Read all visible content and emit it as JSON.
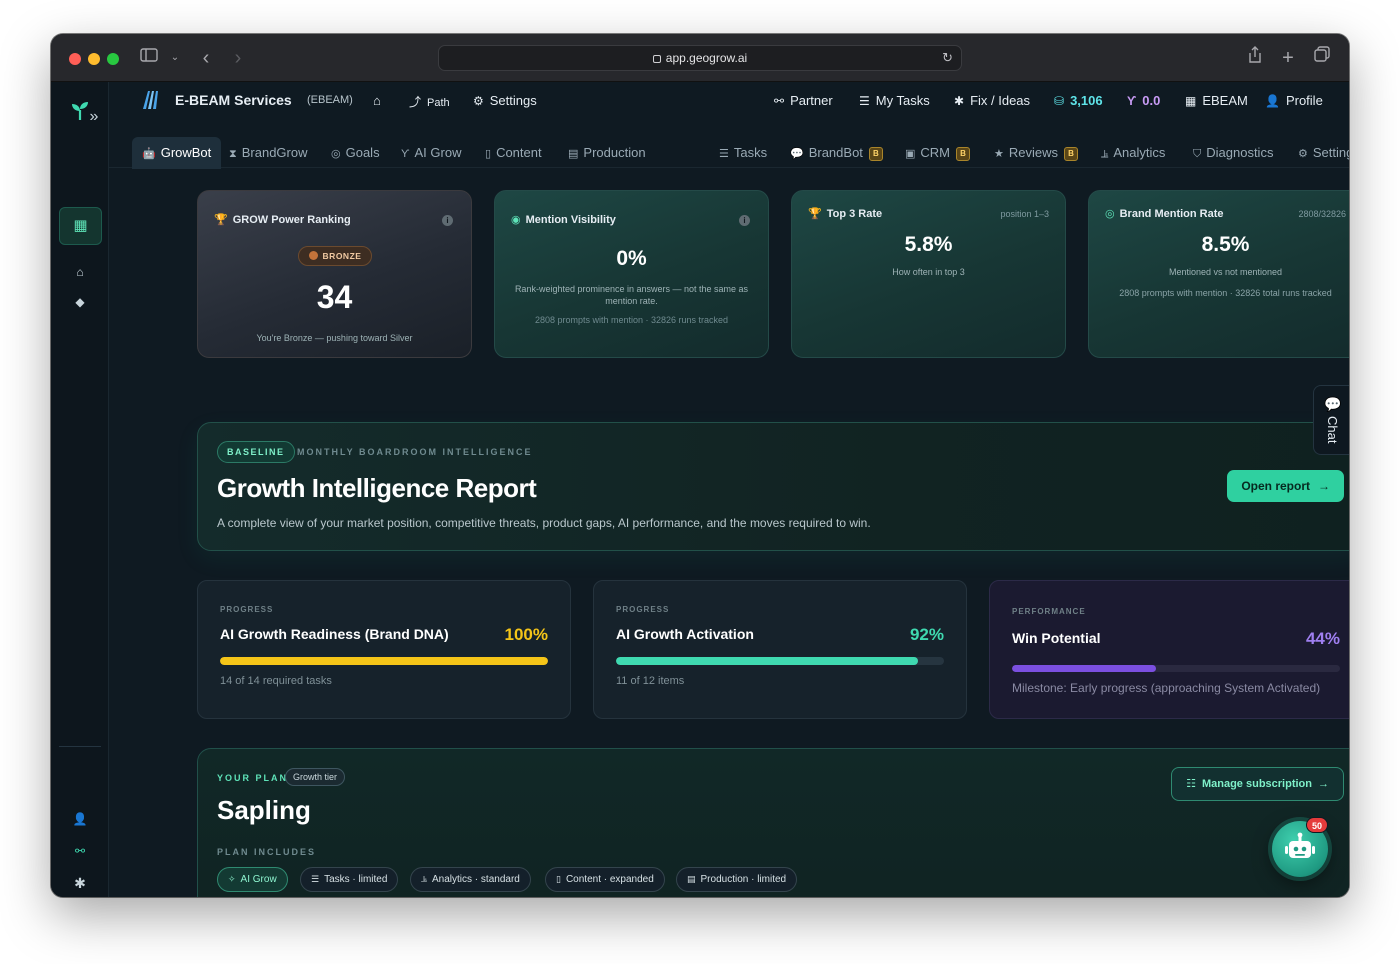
{
  "browser": {
    "url": "app.geogrow.ai"
  },
  "topnav": {
    "brand": "E-BEAM Services",
    "code": "(EBEAM)",
    "path": "Path",
    "settings": "Settings",
    "partner": "Partner",
    "my_tasks": "My Tasks",
    "fix_ideas": "Fix / Ideas",
    "credits": "3,106",
    "score": "0.0",
    "org": "EBEAM",
    "profile": "Profile"
  },
  "tabs": [
    {
      "label": "GrowBot",
      "active": true
    },
    {
      "label": "BrandGrow"
    },
    {
      "label": "Goals"
    },
    {
      "label": "AI Grow"
    },
    {
      "label": "Content"
    },
    {
      "label": "Production"
    },
    {
      "label": "Tasks"
    },
    {
      "label": "BrandBot",
      "badge": "B"
    },
    {
      "label": "CRM",
      "badge": "B"
    },
    {
      "label": "Reviews",
      "badge": "B"
    },
    {
      "label": "Analytics"
    },
    {
      "label": "Diagnostics"
    },
    {
      "label": "Settings"
    }
  ],
  "cards": {
    "rank": {
      "title": "GROW Power Ranking",
      "tier": "BRONZE",
      "value": "34",
      "note": "You're Bronze — pushing toward Silver"
    },
    "visibility": {
      "title": "Mention Visibility",
      "value": "0%",
      "desc": "Rank-weighted prominence in answers — not the same as mention rate.",
      "meta": "2808 prompts with mention · 32826 runs tracked"
    },
    "top3": {
      "title": "Top 3 Rate",
      "corner": "position 1–3",
      "value": "5.8%",
      "desc": "How often in top 3"
    },
    "brand_mention": {
      "title": "Brand Mention Rate",
      "corner": "2808/32826",
      "value": "8.5%",
      "desc": "Mentioned vs not mentioned",
      "meta": "2808 prompts with mention · 32826 total runs tracked"
    }
  },
  "report": {
    "badge": "BASELINE",
    "eyebrow": "MONTHLY BOARDROOM INTELLIGENCE",
    "title": "Growth Intelligence Report",
    "desc": "A complete view of your market position, competitive threats, product gaps, AI performance, and the moves required to win.",
    "button": "Open report"
  },
  "progress": [
    {
      "label": "PROGRESS",
      "title": "AI Growth Readiness (Brand DNA)",
      "value": "100%",
      "fraction": 1.0,
      "color": "#f5c518",
      "note": "14 of 14 required tasks"
    },
    {
      "label": "PROGRESS",
      "title": "AI Growth Activation",
      "value": "92%",
      "fraction": 0.92,
      "color": "#3fd9b0",
      "note": "11 of 12 items"
    },
    {
      "label": "PERFORMANCE",
      "title": "Win Potential",
      "value": "44%",
      "fraction": 0.44,
      "color": "#7b4fe0",
      "note": "Milestone: Early progress (approaching System Activated)"
    }
  ],
  "plan": {
    "eyebrow": "YOUR PLAN",
    "tier": "Growth tier",
    "name": "Sapling",
    "includes_label": "PLAN INCLUDES",
    "manage": "Manage subscription",
    "chips": [
      {
        "label": "AI Grow",
        "on": true
      },
      {
        "label": "Tasks · limited"
      },
      {
        "label": "Analytics · standard"
      },
      {
        "label": "Content · expanded"
      },
      {
        "label": "Production · limited"
      }
    ]
  },
  "chat": {
    "label": "Chat"
  },
  "bot": {
    "badge": "50"
  },
  "colors": {
    "accent": "#2fd0a0",
    "bg": "#0f1a22",
    "gold": "#f5c518",
    "violet": "#7b4fe0"
  }
}
